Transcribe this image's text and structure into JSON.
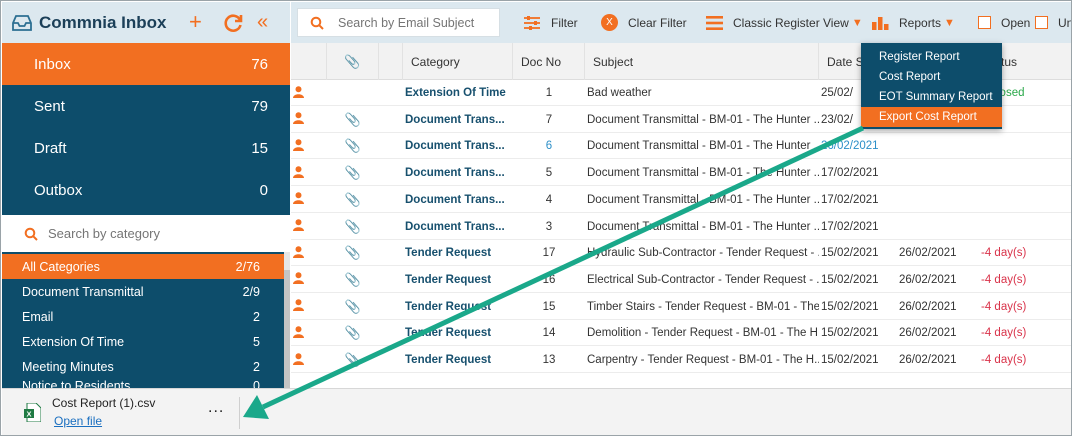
{
  "sidebar": {
    "title": "Commnia Inbox",
    "nav": [
      {
        "label": "Inbox",
        "count": "76"
      },
      {
        "label": "Sent",
        "count": "79"
      },
      {
        "label": "Draft",
        "count": "15"
      },
      {
        "label": "Outbox",
        "count": "0"
      }
    ],
    "search_placeholder": "Search by category",
    "categories": [
      {
        "label": "All Categories",
        "count": "2/76"
      },
      {
        "label": "Document Transmittal",
        "count": "2/9"
      },
      {
        "label": "Email",
        "count": "2"
      },
      {
        "label": "Extension Of Time",
        "count": "5"
      },
      {
        "label": "Meeting Minutes",
        "count": "2"
      },
      {
        "label": "Notice to Residents",
        "count": "0"
      }
    ]
  },
  "toolbar": {
    "search_placeholder": "Search by Email Subject",
    "filter_label": "Filter",
    "clear_filter_label": "Clear Filter",
    "view_label": "Classic Register View",
    "reports_label": "Reports",
    "open_label": "Open",
    "unread_label": "Un"
  },
  "grid": {
    "headers": {
      "category": "Category",
      "docno": "Doc No",
      "subject": "Subject",
      "date_sent": "Date Se",
      "status": "tus"
    },
    "rows": [
      {
        "category": "Extension Of Time",
        "docno": "1",
        "subject": "Bad weather",
        "date1": "25/02/",
        "date2": "",
        "status": "losed",
        "attach": false,
        "selected": false
      },
      {
        "category": "Document Trans...",
        "docno": "7",
        "subject": "Document Transmittal - BM-01 - The Hunter ...",
        "date1": "23/02/",
        "date2": "",
        "status": "",
        "attach": true,
        "selected": false
      },
      {
        "category": "Document Trans...",
        "docno": "6",
        "subject": "Document Transmittal - BM-01 - The Hunter ...",
        "date1": "26/02/2021",
        "date2": "",
        "status": "",
        "attach": true,
        "selected": true
      },
      {
        "category": "Document Trans...",
        "docno": "5",
        "subject": "Document Transmittal - BM-01 - The Hunter ...",
        "date1": "17/02/2021",
        "date2": "",
        "status": "",
        "attach": true,
        "selected": false
      },
      {
        "category": "Document Trans...",
        "docno": "4",
        "subject": "Document Transmittal - BM-01 - The Hunter ...",
        "date1": "17/02/2021",
        "date2": "",
        "status": "",
        "attach": true,
        "selected": false
      },
      {
        "category": "Document Trans...",
        "docno": "3",
        "subject": "Document Transmittal - BM-01 - The Hunter ...",
        "date1": "17/02/2021",
        "date2": "",
        "status": "",
        "attach": true,
        "selected": false
      },
      {
        "category": "Tender Request",
        "docno": "17",
        "subject": "Hydraulic Sub-Contractor - Tender Request - ...",
        "date1": "15/02/2021",
        "date2": "26/02/2021",
        "status": "-4 day(s)",
        "attach": true,
        "selected": false
      },
      {
        "category": "Tender Request",
        "docno": "16",
        "subject": "Electrical Sub-Contractor - Tender Request - ...",
        "date1": "15/02/2021",
        "date2": "26/02/2021",
        "status": "-4 day(s)",
        "attach": true,
        "selected": false
      },
      {
        "category": "Tender Request",
        "docno": "15",
        "subject": "Timber Stairs - Tender Request - BM-01 - The...",
        "date1": "15/02/2021",
        "date2": "26/02/2021",
        "status": "-4 day(s)",
        "attach": true,
        "selected": false
      },
      {
        "category": "Tender Request",
        "docno": "14",
        "subject": "Demolition - Tender Request - BM-01 - The H...",
        "date1": "15/02/2021",
        "date2": "26/02/2021",
        "status": "-4 day(s)",
        "attach": true,
        "selected": false
      },
      {
        "category": "Tender Request",
        "docno": "13",
        "subject": "Carpentry - Tender Request - BM-01 - The H...",
        "date1": "15/02/2021",
        "date2": "26/02/2021",
        "status": "-4 day(s)",
        "attach": true,
        "selected": false
      }
    ]
  },
  "reports_menu": {
    "items": [
      "Register Report",
      "Cost Report",
      "EOT Summary Report",
      "Export Cost Report"
    ],
    "active_index": 3
  },
  "download": {
    "filename": "Cost Report (1).csv",
    "open_label": "Open file",
    "more_label": "..."
  },
  "colors": {
    "accent": "#f26f21",
    "primary": "#0d4d6b",
    "toolbar_bg": "#dce8ef",
    "arrow": "#1aa88a",
    "overdue": "#d9334a",
    "link": "#2c8fc8"
  }
}
